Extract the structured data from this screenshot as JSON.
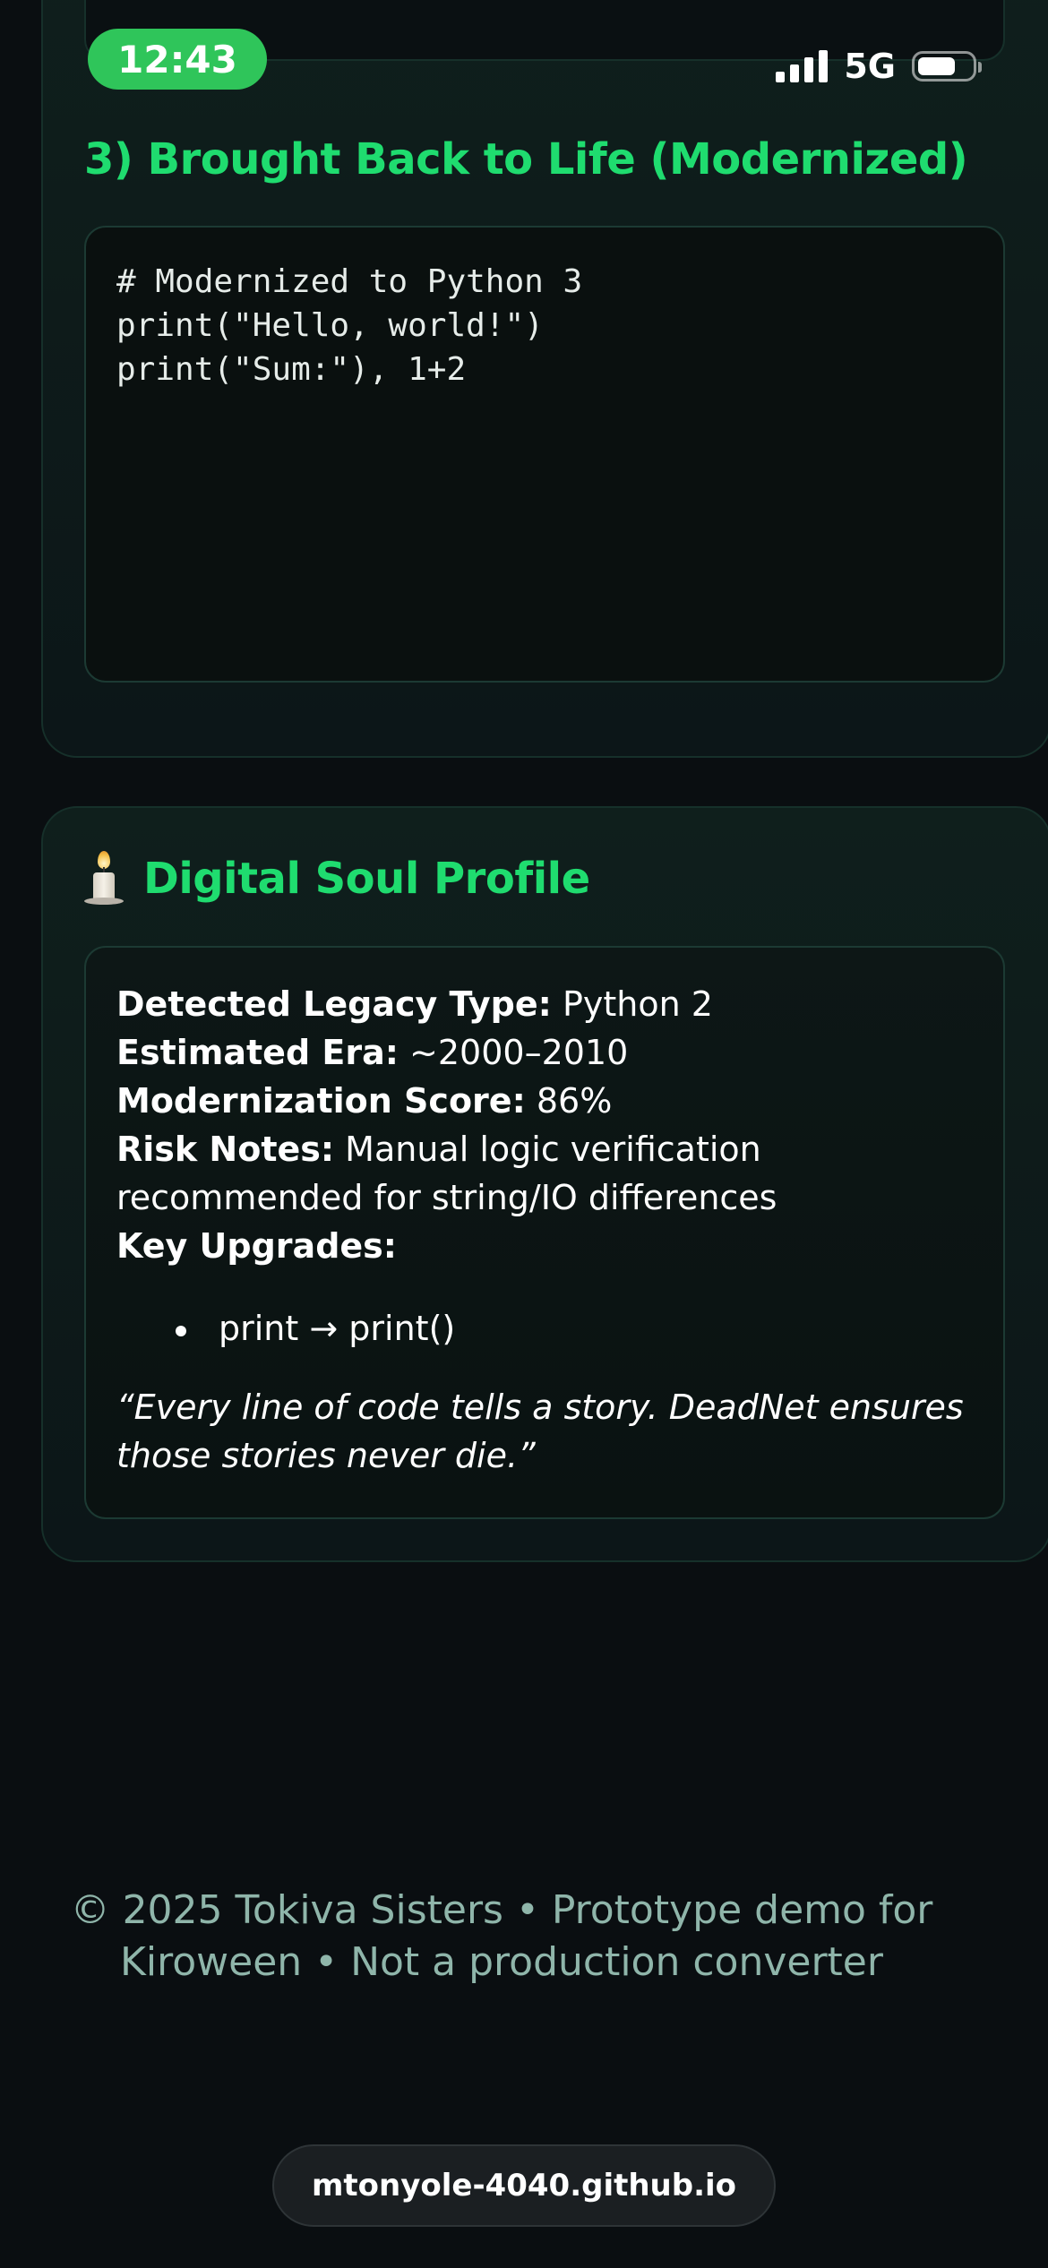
{
  "status_bar": {
    "time": "12:43",
    "network": "5G",
    "battery_level": 0.7
  },
  "modernized": {
    "title": "3) Brought Back to Life (Modernized)",
    "code_lines": [
      "# Modernized to Python 3",
      "print(\"Hello, world!\")",
      "print(\"Sum:\"), 1+2"
    ]
  },
  "soul_profile": {
    "icon": "candle-icon",
    "title": "Digital Soul Profile",
    "legacy_type_label": "Detected Legacy Type:",
    "legacy_type_value": "Python 2",
    "era_label": "Estimated Era:",
    "era_value": "~2000–2010",
    "score_label": "Modernization Score:",
    "score_value": "86%",
    "risk_label": "Risk Notes:",
    "risk_value": "Manual logic verification recommended for string/IO differences",
    "upgrades_label": "Key Upgrades:",
    "upgrades": [
      "print → print()"
    ],
    "quote": "“Every line of code tells a story. DeadNet ensures those stories never die.”"
  },
  "footer": {
    "text": "© 2025 Tokiva Sisters • Prototype demo for Kiroween • Not a production converter"
  },
  "browser": {
    "url": "mtonyole-4040.github.io"
  },
  "colors": {
    "accent_green": "#1fdc6f",
    "time_pill": "#2fc55a",
    "background": "#0a0e11"
  }
}
